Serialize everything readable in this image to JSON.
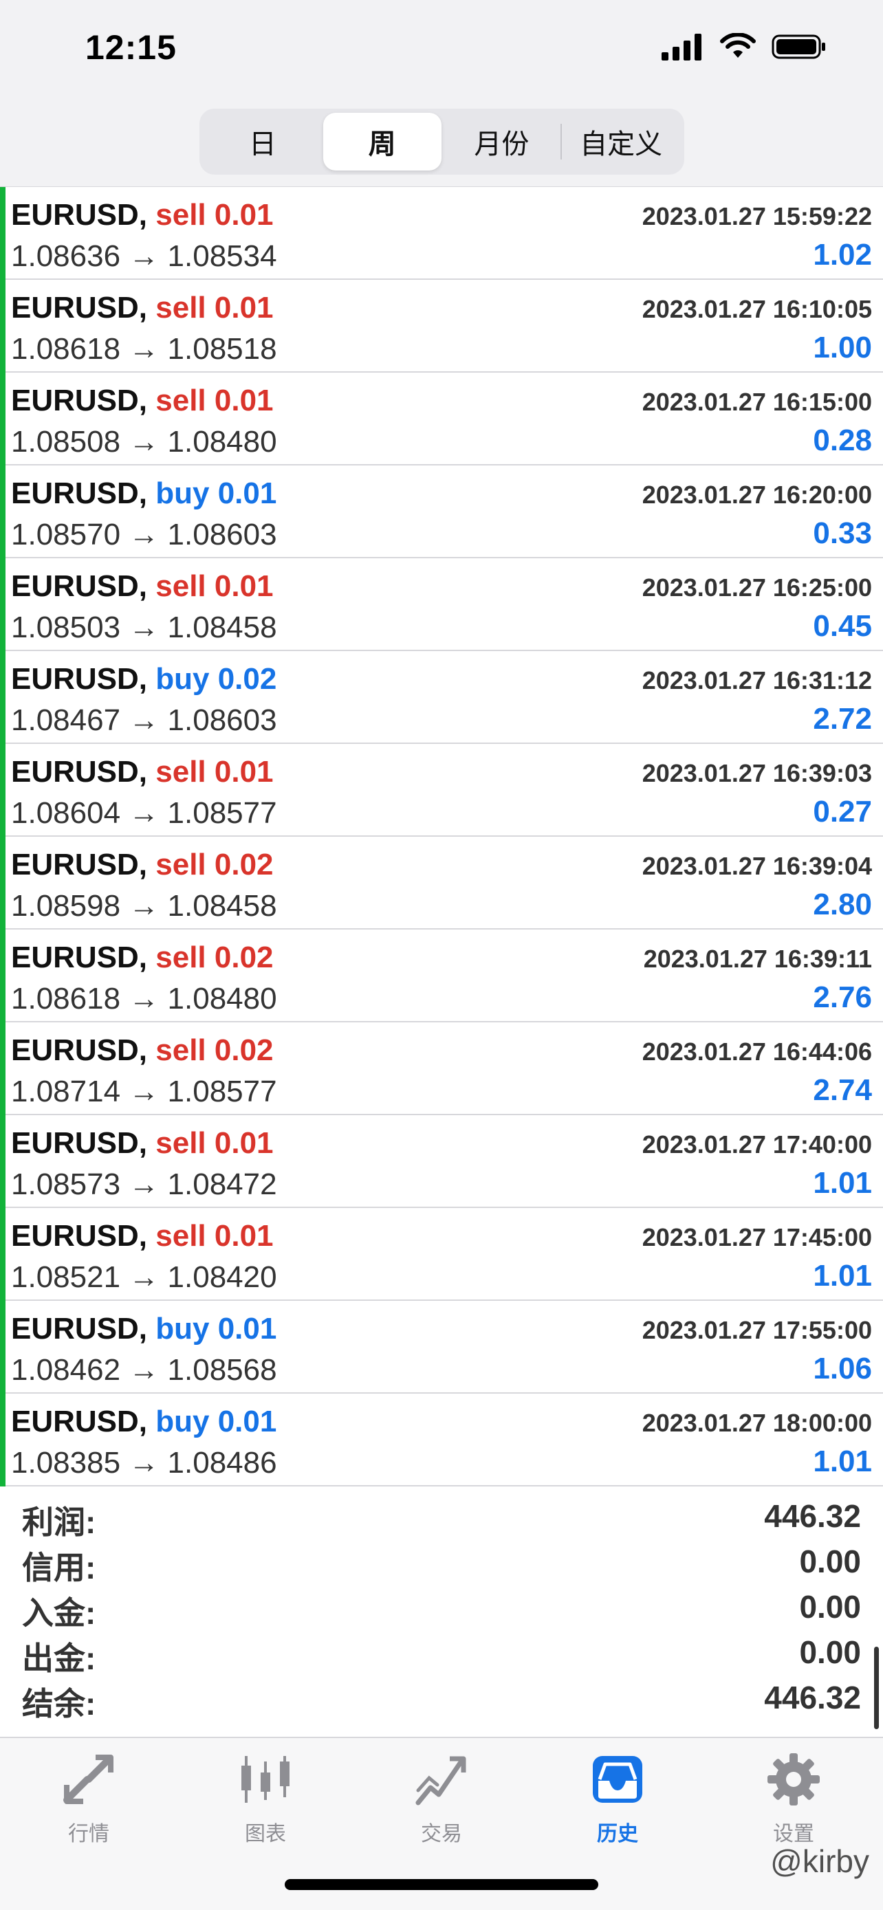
{
  "status": {
    "time": "12:15"
  },
  "segments": [
    {
      "label": "日",
      "active": false
    },
    {
      "label": "周",
      "active": true
    },
    {
      "label": "月份",
      "active": false
    },
    {
      "label": "自定义",
      "active": false
    }
  ],
  "trades": [
    {
      "symbol": "EURUSD,",
      "side": "sell",
      "volume": "0.01",
      "time": "2023.01.27 15:59:22",
      "open": "1.08636",
      "close": "1.08534",
      "profit": "1.02"
    },
    {
      "symbol": "EURUSD,",
      "side": "sell",
      "volume": "0.01",
      "time": "2023.01.27 16:10:05",
      "open": "1.08618",
      "close": "1.08518",
      "profit": "1.00"
    },
    {
      "symbol": "EURUSD,",
      "side": "sell",
      "volume": "0.01",
      "time": "2023.01.27 16:15:00",
      "open": "1.08508",
      "close": "1.08480",
      "profit": "0.28"
    },
    {
      "symbol": "EURUSD,",
      "side": "buy",
      "volume": "0.01",
      "time": "2023.01.27 16:20:00",
      "open": "1.08570",
      "close": "1.08603",
      "profit": "0.33"
    },
    {
      "symbol": "EURUSD,",
      "side": "sell",
      "volume": "0.01",
      "time": "2023.01.27 16:25:00",
      "open": "1.08503",
      "close": "1.08458",
      "profit": "0.45"
    },
    {
      "symbol": "EURUSD,",
      "side": "buy",
      "volume": "0.02",
      "time": "2023.01.27 16:31:12",
      "open": "1.08467",
      "close": "1.08603",
      "profit": "2.72"
    },
    {
      "symbol": "EURUSD,",
      "side": "sell",
      "volume": "0.01",
      "time": "2023.01.27 16:39:03",
      "open": "1.08604",
      "close": "1.08577",
      "profit": "0.27"
    },
    {
      "symbol": "EURUSD,",
      "side": "sell",
      "volume": "0.02",
      "time": "2023.01.27 16:39:04",
      "open": "1.08598",
      "close": "1.08458",
      "profit": "2.80"
    },
    {
      "symbol": "EURUSD,",
      "side": "sell",
      "volume": "0.02",
      "time": "2023.01.27 16:39:11",
      "open": "1.08618",
      "close": "1.08480",
      "profit": "2.76"
    },
    {
      "symbol": "EURUSD,",
      "side": "sell",
      "volume": "0.02",
      "time": "2023.01.27 16:44:06",
      "open": "1.08714",
      "close": "1.08577",
      "profit": "2.74"
    },
    {
      "symbol": "EURUSD,",
      "side": "sell",
      "volume": "0.01",
      "time": "2023.01.27 17:40:00",
      "open": "1.08573",
      "close": "1.08472",
      "profit": "1.01"
    },
    {
      "symbol": "EURUSD,",
      "side": "sell",
      "volume": "0.01",
      "time": "2023.01.27 17:45:00",
      "open": "1.08521",
      "close": "1.08420",
      "profit": "1.01"
    },
    {
      "symbol": "EURUSD,",
      "side": "buy",
      "volume": "0.01",
      "time": "2023.01.27 17:55:00",
      "open": "1.08462",
      "close": "1.08568",
      "profit": "1.06"
    },
    {
      "symbol": "EURUSD,",
      "side": "buy",
      "volume": "0.01",
      "time": "2023.01.27 18:00:00",
      "open": "1.08385",
      "close": "1.08486",
      "profit": "1.01"
    }
  ],
  "arrow": "→",
  "summary": [
    {
      "label": "利润:",
      "value": "446.32"
    },
    {
      "label": "信用:",
      "value": "0.00"
    },
    {
      "label": "入金:",
      "value": "0.00"
    },
    {
      "label": "出金:",
      "value": "0.00"
    },
    {
      "label": "结余:",
      "value": "446.32"
    }
  ],
  "tabs": [
    {
      "label": "行情",
      "icon": "quotes-icon",
      "active": false
    },
    {
      "label": "图表",
      "icon": "chart-icon",
      "active": false
    },
    {
      "label": "交易",
      "icon": "trade-icon",
      "active": false
    },
    {
      "label": "历史",
      "icon": "history-icon",
      "active": true
    },
    {
      "label": "设置",
      "icon": "settings-icon",
      "active": false
    }
  ],
  "watermark": "@kirby",
  "colors": {
    "sell": "#d9342b",
    "buy": "#1673e6",
    "accent": "#1673e6",
    "rowBar": "#12b33a",
    "tabInactive": "#8e8e93"
  }
}
